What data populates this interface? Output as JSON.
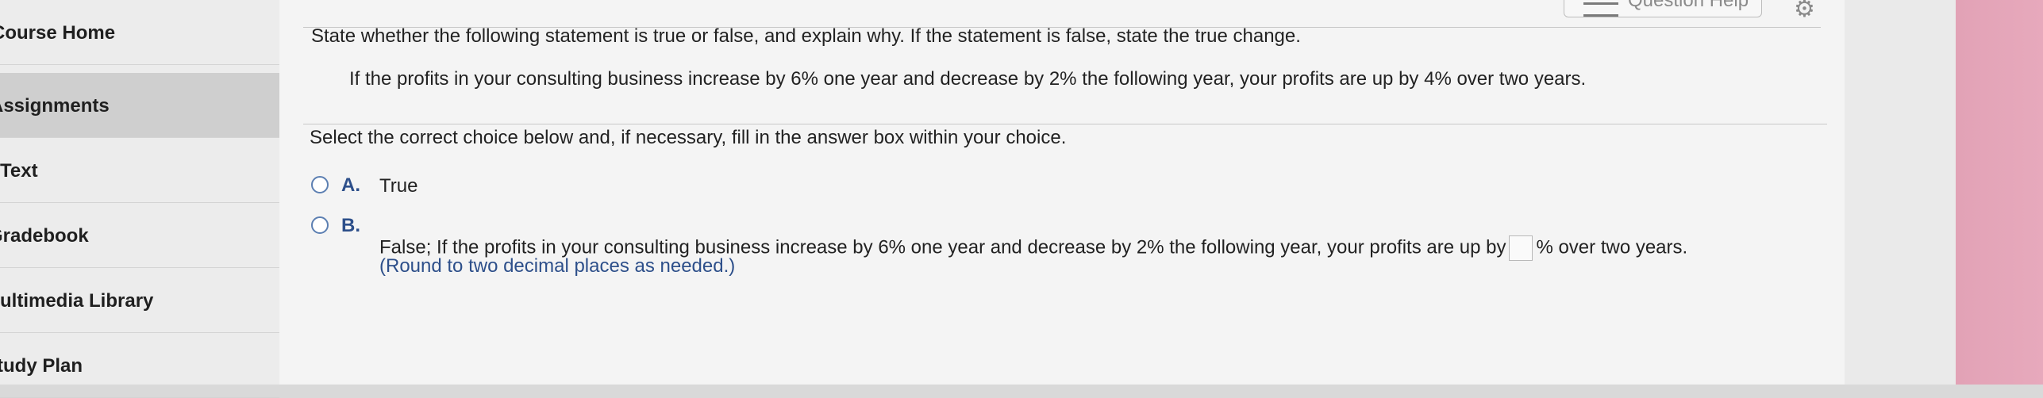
{
  "sidebar": {
    "items": [
      {
        "label": "Course Home"
      },
      {
        "label": "Assignments"
      },
      {
        "label": "Text"
      },
      {
        "label": "Gradebook"
      },
      {
        "label": "Multimedia Library"
      },
      {
        "label": "Study Plan"
      }
    ]
  },
  "header": {
    "help_label": "Question Help",
    "help_icon": "list-icon",
    "settings_icon": "gear-icon"
  },
  "question": {
    "instruction": "State whether the following statement is true or false, and explain why. If the statement is false, state the true change.",
    "statement": "If the profits in your consulting business increase by 6% one year and decrease by 2% the following year, your profits are up by 4% over two years.",
    "select_prompt": "Select the correct choice below and, if necessary, fill in the answer box within your choice."
  },
  "choices": [
    {
      "letter": "A.",
      "text": "True"
    },
    {
      "letter": "B.",
      "text_before": "False; If the profits in your consulting business increase by 6% one year and decrease by 2% the following year, your profits are up by",
      "text_after": "% over two years.",
      "answer_value": "",
      "hint": "(Round to two decimal places as needed.)"
    }
  ],
  "colors": {
    "accent": "#2d4f8a",
    "radio_border": "#5c7fb2",
    "sidebar_bg": "#ececec",
    "main_bg": "#f4f4f4",
    "edge_pink": "#e2a2b6"
  }
}
